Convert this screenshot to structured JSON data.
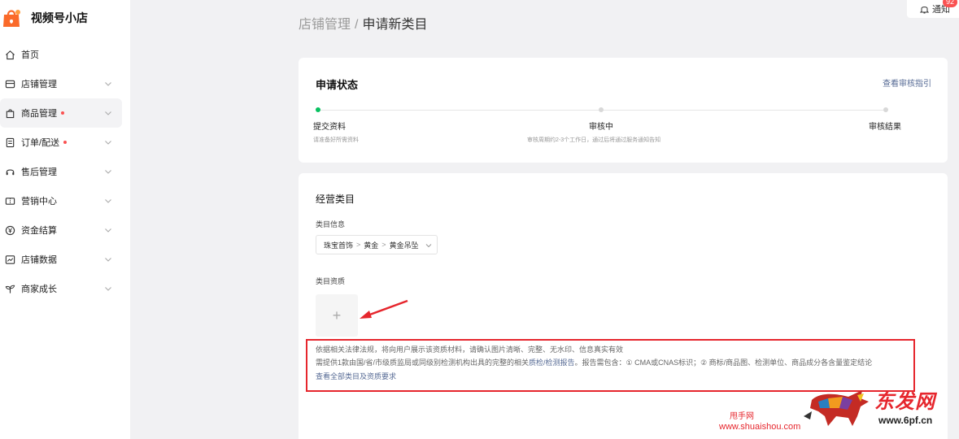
{
  "app": {
    "title": "视频号小店"
  },
  "sidebar": {
    "items": [
      {
        "label": "首页",
        "icon": "home-icon",
        "has_dot": false,
        "has_chevron": false
      },
      {
        "label": "店铺管理",
        "icon": "store-icon",
        "has_dot": false,
        "has_chevron": true
      },
      {
        "label": "商品管理",
        "icon": "shopping-bag-icon",
        "has_dot": true,
        "has_chevron": true,
        "active": true
      },
      {
        "label": "订单/配送",
        "icon": "order-icon",
        "has_dot": true,
        "has_chevron": true
      },
      {
        "label": "售后管理",
        "icon": "headset-icon",
        "has_dot": false,
        "has_chevron": true
      },
      {
        "label": "营销中心",
        "icon": "coupon-icon",
        "has_dot": false,
        "has_chevron": true
      },
      {
        "label": "资金结算",
        "icon": "yen-icon",
        "has_dot": false,
        "has_chevron": true
      },
      {
        "label": "店铺数据",
        "icon": "chart-icon",
        "has_dot": false,
        "has_chevron": true
      },
      {
        "label": "商家成长",
        "icon": "sprout-icon",
        "has_dot": false,
        "has_chevron": true
      }
    ]
  },
  "header": {
    "breadcrumb_parent": "店铺管理",
    "breadcrumb_sep": "/",
    "breadcrumb_current": "申请新类目",
    "notice_label": "通知",
    "notice_count": "92"
  },
  "status_card": {
    "title": "申请状态",
    "guide_link": "查看审核指引",
    "steps": [
      {
        "label": "提交资料",
        "desc": "请准备好所需资料",
        "done": true
      },
      {
        "label": "审核中",
        "desc": "审核周期约2-3个工作日，通过后将通过服务通知告知",
        "done": false
      },
      {
        "label": "审核结果",
        "desc": "",
        "done": false
      }
    ]
  },
  "category_card": {
    "title": "经营类目",
    "info_label": "类目信息",
    "path": [
      "珠宝首饰",
      "黄金",
      "黄金吊坠"
    ],
    "path_sep": ">",
    "qualification_label": "类目资质",
    "upload_plus": "+",
    "tips": {
      "line1": "依据相关法律法规，将向用户展示该资质材料，请确认图片清晰、完整、无水印、信息真实有效",
      "line2_prefix": "需提供1款由国/省/市级质监局或同级别检测机构出具的完整的相关",
      "line2_link": "质检/检测报告",
      "line2_suffix": "。报告需包含：① CMA或CNAS标识；② 商标/商品图、检测单位、商品成分各含量鉴定结论",
      "line3_link": "查看全部类目及资质要求"
    }
  },
  "watermark": {
    "site_name": "甩手网",
    "site_url": "www.shuaishou.com",
    "brand": "东发网",
    "brand_url": "www.6pf.cn"
  },
  "colors": {
    "accent_green": "#07c160",
    "link_blue": "#576b95",
    "highlight_red": "#e6262d",
    "dot_red": "#fa5151"
  }
}
